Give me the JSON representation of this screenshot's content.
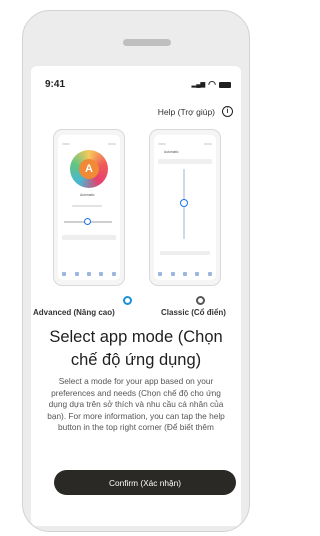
{
  "status_bar": {
    "time": "9:41",
    "signal_glyph": "▂▄▆",
    "wifi_glyph": "◠"
  },
  "help": {
    "label": "Help (Trợ giúp)",
    "icon": "info-icon",
    "icon_glyph": "i"
  },
  "modes": [
    {
      "label": "Advanced (Nâng cao)",
      "selected": true
    },
    {
      "label": "Classic (Cổ điển)",
      "selected": false
    }
  ],
  "preview_advanced": {
    "badge": "A",
    "profile": "Automatic"
  },
  "preview_classic": {
    "profile": "Automatic"
  },
  "title": "Select app mode (Chọn chế độ ứng dụng)",
  "description": "Select a mode for your app based on your preferences and needs (Chọn chế độ cho ứng dụng dựa trên sở thích và nhu cầu cá nhân của bạn). For more information, you can tap the help button in the top right corner (Để biết thêm",
  "confirm_button": "Confirm (Xác nhận)",
  "colors": {
    "accent": "#1e90d8",
    "button": "#2b2926"
  }
}
